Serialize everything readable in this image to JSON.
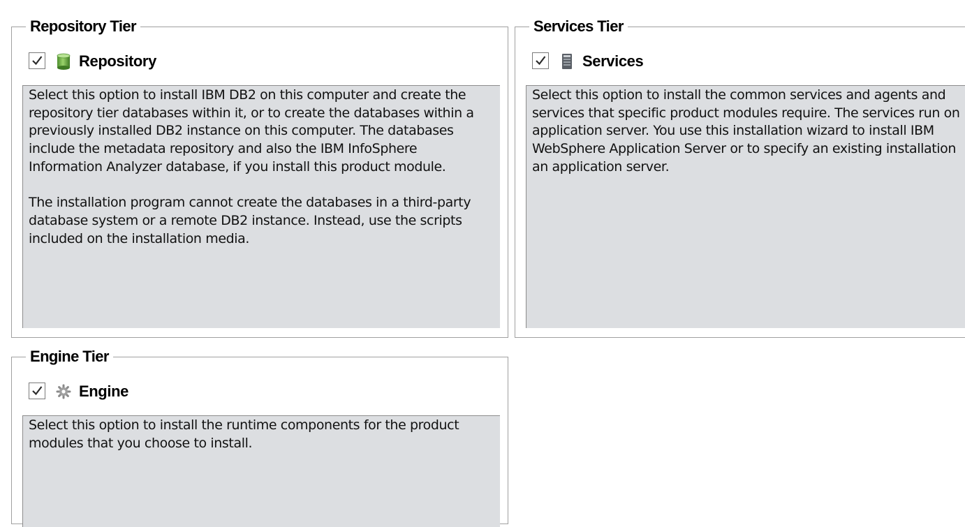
{
  "repository": {
    "title": "Repository Tier",
    "checkbox_checked": true,
    "label": "Repository",
    "icon": "database-icon",
    "description": "Select this option to install IBM DB2 on this computer and create the\nrepository tier databases within it, or to create the databases within a\npreviously installed DB2 instance on this computer. The databases\ninclude the metadata repository and also the IBM InfoSphere\nInformation Analyzer database, if you install this product module.\n\nThe installation program cannot create the databases in a third-party\ndatabase system or a remote DB2 instance. Instead, use the scripts\nincluded on the installation media."
  },
  "services": {
    "title": "Services Tier",
    "checkbox_checked": true,
    "label": "Services",
    "icon": "server-icon",
    "description": "Select this option to install the common services and agents and\nservices that specific product modules require. The services run on\napplication server. You use this installation wizard to install IBM\nWebSphere Application Server or to specify an existing installation\nan application server."
  },
  "engine": {
    "title": "Engine Tier",
    "checkbox_checked": true,
    "label": "Engine",
    "icon": "gear-icon",
    "description": "Select this option to install the runtime components for the product\nmodules that you choose to install."
  },
  "colors": {
    "panel_background": "#dcdee1",
    "group_border": "#a0a0a0",
    "database_icon": "#6aa84f"
  }
}
